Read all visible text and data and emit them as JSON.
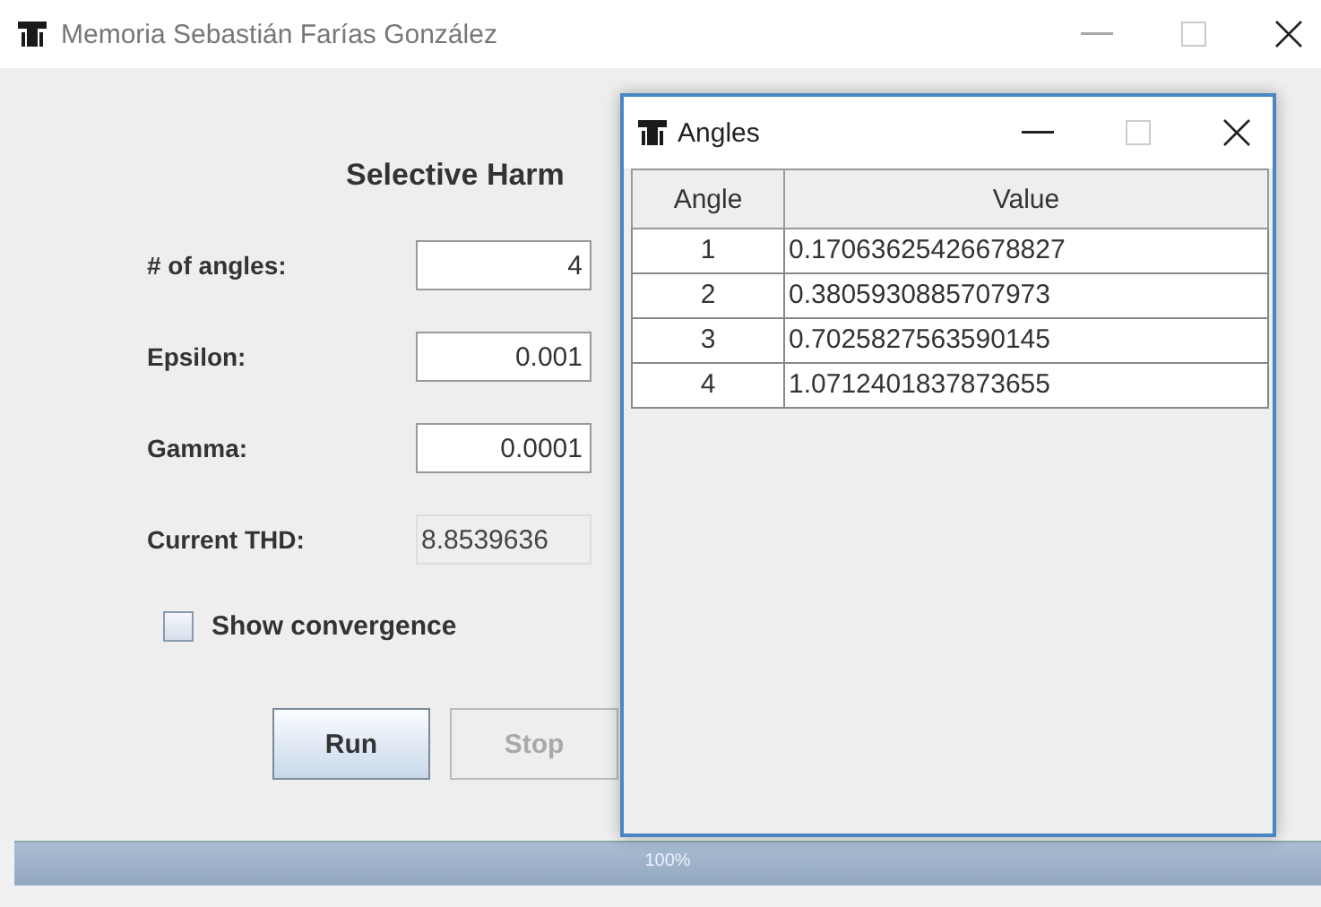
{
  "window": {
    "title": "Memoria Sebastián Farías González"
  },
  "heading": "Selective Harm",
  "fields": [
    {
      "label": "# of angles:",
      "value": "4",
      "editable": true
    },
    {
      "label": "Epsilon:",
      "value": "0.001",
      "editable": true
    },
    {
      "label": "Gamma:",
      "value": "0.0001",
      "editable": true
    },
    {
      "label": "Current THD:",
      "value": "8.8539636",
      "editable": false
    }
  ],
  "show_convergence": {
    "label": "Show convergence",
    "checked": false
  },
  "buttons": [
    {
      "label": "Run",
      "disabled": false
    },
    {
      "label": "Stop",
      "disabled": true
    }
  ],
  "progress": {
    "level": 1,
    "reading": "100%"
  },
  "angles_window": {
    "title": "Angles",
    "table": {
      "columns": [
        "Angle",
        "Value"
      ],
      "rows": [
        [
          "1",
          "0.17063625426678827"
        ],
        [
          "2",
          "0.3805930885707973"
        ],
        [
          "3",
          "0.7025827563590145"
        ],
        [
          "4",
          "1.0712401837873655"
        ]
      ]
    }
  }
}
